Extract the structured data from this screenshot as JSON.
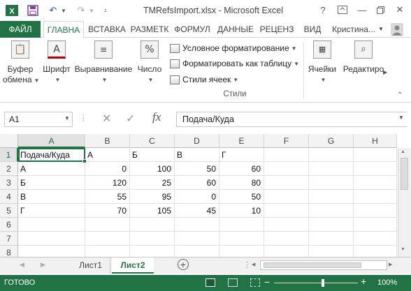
{
  "title": "TMRefsImport.xlsx - Microsoft Excel",
  "tabs": {
    "file": "ФАЙЛ",
    "items": [
      "ГЛАВНА",
      "ВСТАВКА",
      "РАЗМЕТК",
      "ФОРМУЛ",
      "ДАННЫЕ",
      "РЕЦЕНЗ",
      "ВИД"
    ],
    "user": "Кристина..."
  },
  "ribbon": {
    "clipboard_line1": "Буфер",
    "clipboard_line2": "обмена",
    "font": "Шрифт",
    "alignment": "Выравнивание",
    "number": "Число",
    "cond_format": "Условное форматирование",
    "format_table": "Форматировать как таблицу",
    "cell_styles": "Стили ячеек",
    "styles_group": "Стили",
    "cells": "Ячейки",
    "editing": "Редактиро"
  },
  "formula_bar": {
    "name_box": "A1",
    "fx": "fx",
    "value": "Подача/Куда"
  },
  "grid": {
    "columns": [
      "A",
      "B",
      "C",
      "D",
      "E",
      "F",
      "G",
      "H"
    ],
    "rows": [
      "1",
      "2",
      "3",
      "4",
      "5",
      "6",
      "7",
      "8"
    ],
    "cells": [
      [
        "Подача/Куда",
        "А",
        "Б",
        "В",
        "Г",
        "",
        "",
        ""
      ],
      [
        "А",
        "0",
        "100",
        "50",
        "60",
        "",
        "",
        ""
      ],
      [
        "Б",
        "120",
        "25",
        "60",
        "80",
        "",
        "",
        ""
      ],
      [
        "В",
        "55",
        "95",
        "0",
        "50",
        "",
        "",
        ""
      ],
      [
        "Г",
        "70",
        "105",
        "45",
        "10",
        "",
        "",
        ""
      ],
      [
        "",
        "",
        "",
        "",
        "",
        "",
        "",
        ""
      ],
      [
        "",
        "",
        "",
        "",
        "",
        "",
        "",
        ""
      ],
      [
        "",
        "",
        "",
        "",
        "",
        "",
        "",
        ""
      ]
    ]
  },
  "sheets": [
    "Лист1",
    "Лист2"
  ],
  "active_sheet": "Лист2",
  "status": {
    "ready": "ГОТОВО",
    "zoom": "100%"
  },
  "colors": {
    "accent": "#217346"
  }
}
